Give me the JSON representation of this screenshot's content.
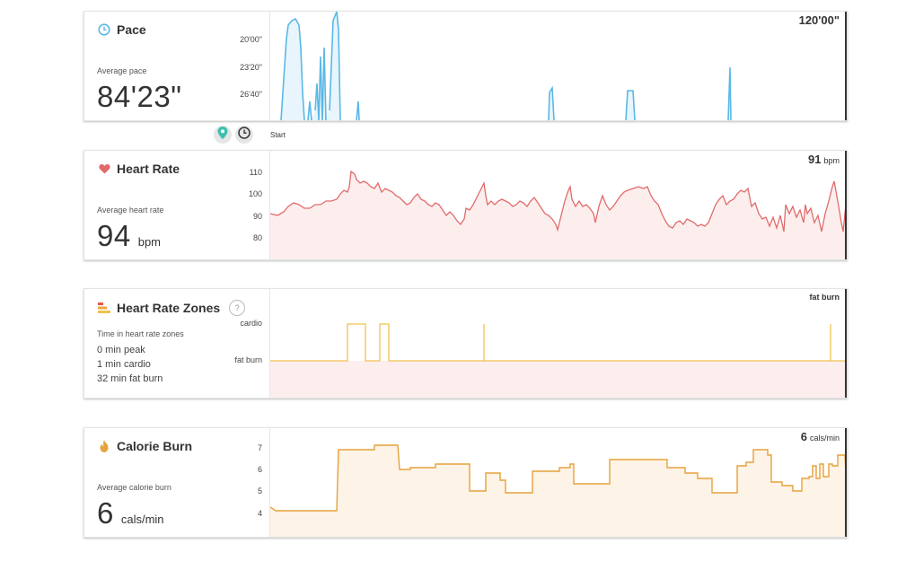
{
  "colors": {
    "pace": "#5ab8e6",
    "heart": "#e06b6b",
    "heart_fill": "#fdeeee",
    "zone": "#f0c24e",
    "calorie": "#e6a23c",
    "calorie_fill": "#fdf3e7"
  },
  "pace": {
    "title": "Pace",
    "icon": "clock-icon",
    "sublabel": "Average pace",
    "value": "84'23\"",
    "yticks": [
      "20'00\"",
      "23'20\"",
      "26'40\""
    ],
    "readout": "120'00\""
  },
  "controls": {
    "map_icon": "map-pin-icon",
    "time_icon": "clock-icon",
    "start_label": "Start"
  },
  "heart": {
    "title": "Heart Rate",
    "icon": "heart-icon",
    "sublabel": "Average heart rate",
    "value": "94",
    "unit": "bpm",
    "yticks": [
      "110",
      "100",
      "90",
      "80"
    ],
    "readout_value": "91",
    "readout_unit": "bpm"
  },
  "zones": {
    "title": "Heart Rate Zones",
    "icon": "zones-icon",
    "help": "?",
    "sublabel": "Time in heart rate zones",
    "lines": [
      "0 min peak",
      "1 min cardio",
      "32 min fat burn"
    ],
    "yticks": [
      "cardio",
      "fat burn"
    ],
    "readout": "fat burn"
  },
  "calorie": {
    "title": "Calorie Burn",
    "icon": "flame-icon",
    "sublabel": "Average calorie burn",
    "value": "6",
    "unit": "cals/min",
    "yticks": [
      "7",
      "6",
      "5",
      "4"
    ],
    "readout_value": "6",
    "readout_unit": "cals/min"
  }
}
